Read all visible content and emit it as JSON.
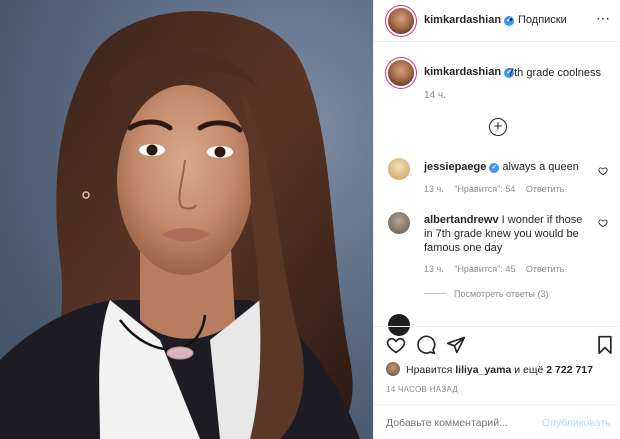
{
  "post": {
    "username": "kimkardashian",
    "follow_status": "Подписки",
    "more_icon": "more-horizontal-icon",
    "caption": "7th grade coolness",
    "caption_time": "14 ч."
  },
  "comments": [
    {
      "username": "jessiepaege",
      "verified": true,
      "text": "always a queen",
      "time": "13 ч.",
      "likes": "\"Нравится\": 54",
      "reply": "Ответить"
    },
    {
      "username": "albertandrewv",
      "verified": false,
      "text": "I wonder if those in 7th grade knew you would be famous one day",
      "time": "13 ч.",
      "likes": "\"Нравится\": 45",
      "reply": "Ответить",
      "view_replies": "Посмотреть ответы (3)"
    }
  ],
  "actions": {
    "liked_by_prefix": "Нравится",
    "liked_by_user": "liliya_yama",
    "liked_by_suffix": "и ещё",
    "likes_count": "2 722 717",
    "posted_ago": "14 ЧАСОВ НАЗАД"
  },
  "composer": {
    "placeholder": "Добавьте комментарий...",
    "publish_label": "Опубликовать"
  },
  "colors": {
    "accent": "#3897f0",
    "publish_disabled": "#b2dffc",
    "muted": "#8e8e8e"
  }
}
